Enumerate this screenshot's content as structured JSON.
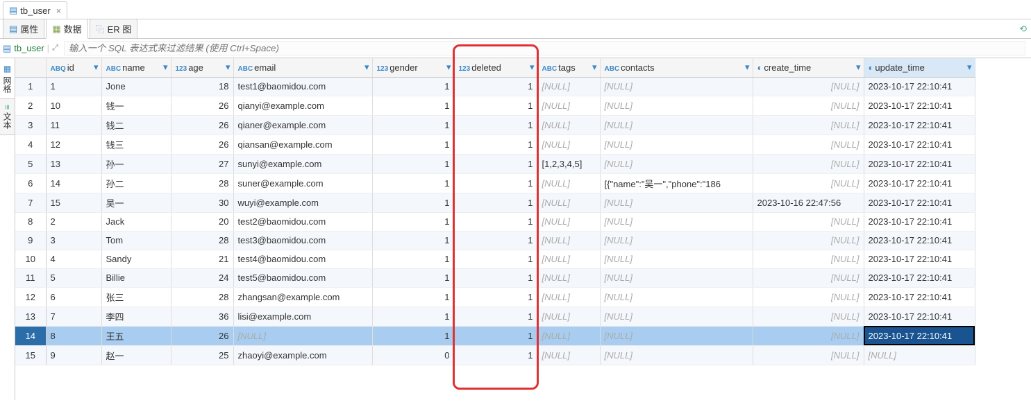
{
  "topTab": {
    "label": "tb_user"
  },
  "subTabs": {
    "props": "属性",
    "data": "数据",
    "er": "ER 图"
  },
  "filterBar": {
    "tableName": "tb_user",
    "hint": "输入一个 SQL 表达式来过滤结果 (使用 Ctrl+Space)"
  },
  "vertTabs": {
    "grid": "网格",
    "text": "文本"
  },
  "nullText": "[NULL]",
  "columns": [
    {
      "key": "id",
      "label": "id",
      "type": "ABQ",
      "cls": "col-id"
    },
    {
      "key": "name",
      "label": "name",
      "type": "ABC",
      "cls": "col-name"
    },
    {
      "key": "age",
      "label": "age",
      "type": "123",
      "cls": "col-age"
    },
    {
      "key": "email",
      "label": "email",
      "type": "ABC",
      "cls": "col-email"
    },
    {
      "key": "gender",
      "label": "gender",
      "type": "123",
      "cls": "col-gender"
    },
    {
      "key": "deleted",
      "label": "deleted",
      "type": "123",
      "cls": "col-deleted"
    },
    {
      "key": "tags",
      "label": "tags",
      "type": "ABC",
      "cls": "col-tags"
    },
    {
      "key": "contacts",
      "label": "contacts",
      "type": "ABC",
      "cls": "col-contacts"
    },
    {
      "key": "create_time",
      "label": "create_time",
      "type": "clock",
      "cls": "col-create"
    },
    {
      "key": "update_time",
      "label": "update_time",
      "type": "clock",
      "cls": "col-update",
      "selected": true
    }
  ],
  "numericCols": [
    "age",
    "gender",
    "deleted"
  ],
  "rightNullCols": [
    "create_time"
  ],
  "selectedRow": 14,
  "selectedCell": {
    "row": 14,
    "col": "update_time"
  },
  "highlightCol": "deleted",
  "rows": [
    {
      "id": "1",
      "name": "Jone",
      "age": 18,
      "email": "test1@baomidou.com",
      "gender": 1,
      "deleted": 1,
      "tags": null,
      "contacts": null,
      "create_time": null,
      "update_time": "2023-10-17 22:10:41"
    },
    {
      "id": "10",
      "name": "钱一",
      "age": 26,
      "email": "qianyi@example.com",
      "gender": 1,
      "deleted": 1,
      "tags": null,
      "contacts": null,
      "create_time": null,
      "update_time": "2023-10-17 22:10:41"
    },
    {
      "id": "11",
      "name": "钱二",
      "age": 26,
      "email": "qianer@example.com",
      "gender": 1,
      "deleted": 1,
      "tags": null,
      "contacts": null,
      "create_time": null,
      "update_time": "2023-10-17 22:10:41"
    },
    {
      "id": "12",
      "name": "钱三",
      "age": 26,
      "email": "qiansan@example.com",
      "gender": 1,
      "deleted": 1,
      "tags": null,
      "contacts": null,
      "create_time": null,
      "update_time": "2023-10-17 22:10:41"
    },
    {
      "id": "13",
      "name": "孙一",
      "age": 27,
      "email": "sunyi@example.com",
      "gender": 1,
      "deleted": 1,
      "tags": "[1,2,3,4,5]",
      "contacts": null,
      "create_time": null,
      "update_time": "2023-10-17 22:10:41"
    },
    {
      "id": "14",
      "name": "孙二",
      "age": 28,
      "email": "suner@example.com",
      "gender": 1,
      "deleted": 1,
      "tags": null,
      "contacts": "[{\"name\":\"吴一\",\"phone\":\"186",
      "create_time": null,
      "update_time": "2023-10-17 22:10:41"
    },
    {
      "id": "15",
      "name": "吴一",
      "age": 30,
      "email": "wuyi@example.com",
      "gender": 1,
      "deleted": 1,
      "tags": null,
      "contacts": null,
      "create_time": "2023-10-16 22:47:56",
      "update_time": "2023-10-17 22:10:41"
    },
    {
      "id": "2",
      "name": "Jack",
      "age": 20,
      "email": "test2@baomidou.com",
      "gender": 1,
      "deleted": 1,
      "tags": null,
      "contacts": null,
      "create_time": null,
      "update_time": "2023-10-17 22:10:41"
    },
    {
      "id": "3",
      "name": "Tom",
      "age": 28,
      "email": "test3@baomidou.com",
      "gender": 1,
      "deleted": 1,
      "tags": null,
      "contacts": null,
      "create_time": null,
      "update_time": "2023-10-17 22:10:41"
    },
    {
      "id": "4",
      "name": "Sandy",
      "age": 21,
      "email": "test4@baomidou.com",
      "gender": 1,
      "deleted": 1,
      "tags": null,
      "contacts": null,
      "create_time": null,
      "update_time": "2023-10-17 22:10:41"
    },
    {
      "id": "5",
      "name": "Billie",
      "age": 24,
      "email": "test5@baomidou.com",
      "gender": 1,
      "deleted": 1,
      "tags": null,
      "contacts": null,
      "create_time": null,
      "update_time": "2023-10-17 22:10:41"
    },
    {
      "id": "6",
      "name": "张三",
      "age": 28,
      "email": "zhangsan@example.com",
      "gender": 1,
      "deleted": 1,
      "tags": null,
      "contacts": null,
      "create_time": null,
      "update_time": "2023-10-17 22:10:41"
    },
    {
      "id": "7",
      "name": "李四",
      "age": 36,
      "email": "lisi@example.com",
      "gender": 1,
      "deleted": 1,
      "tags": null,
      "contacts": null,
      "create_time": null,
      "update_time": "2023-10-17 22:10:41"
    },
    {
      "id": "8",
      "name": "王五",
      "age": 26,
      "email": null,
      "gender": 1,
      "deleted": 1,
      "tags": null,
      "contacts": null,
      "create_time": null,
      "update_time": "2023-10-17 22:10:41"
    },
    {
      "id": "9",
      "name": "赵一",
      "age": 25,
      "email": "zhaoyi@example.com",
      "gender": 0,
      "deleted": 1,
      "tags": null,
      "contacts": null,
      "create_time": null,
      "update_time": null
    }
  ]
}
